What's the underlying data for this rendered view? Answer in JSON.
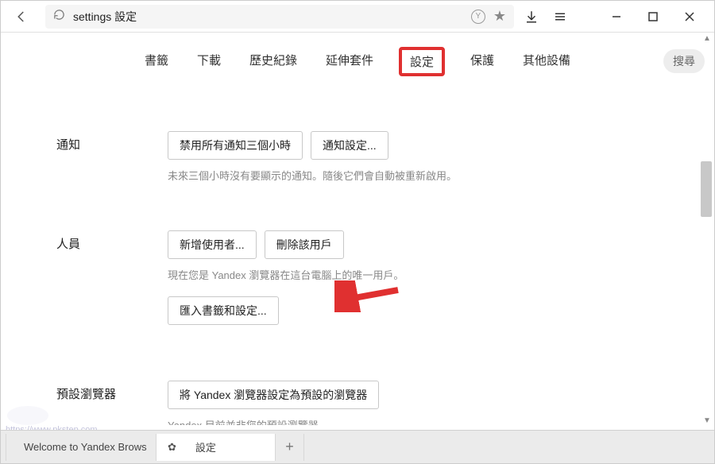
{
  "toolbar": {
    "address": "settings 設定"
  },
  "tabs": {
    "items": [
      "書籤",
      "下載",
      "歷史紀錄",
      "延伸套件",
      "設定",
      "保護",
      "其他設備"
    ],
    "active": "設定",
    "search": "搜尋"
  },
  "sections": {
    "notifications": {
      "label": "通知",
      "disable_btn": "禁用所有通知三個小時",
      "settings_btn": "通知設定...",
      "hint": "未來三個小時沒有要顯示的通知。隨後它們會自動被重新啟用。"
    },
    "people": {
      "label": "人員",
      "add_btn": "新增使用者...",
      "delete_btn": "刪除該用戶",
      "hint": "現在您是 Yandex 瀏覽器在這台電腦上的唯一用戶。",
      "import_btn": "匯入書籤和設定..."
    },
    "default_browser": {
      "label": "預設瀏覽器",
      "set_btn": "將 Yandex 瀏覽器設定為預設的瀏覽器",
      "hint": "Yandex 目前並非您的預設瀏覽器。"
    }
  },
  "bottom_tabs": {
    "tab1": "Welcome to Yandex Brows",
    "tab2": "設定"
  },
  "watermark": "https://www.pkstep.com"
}
